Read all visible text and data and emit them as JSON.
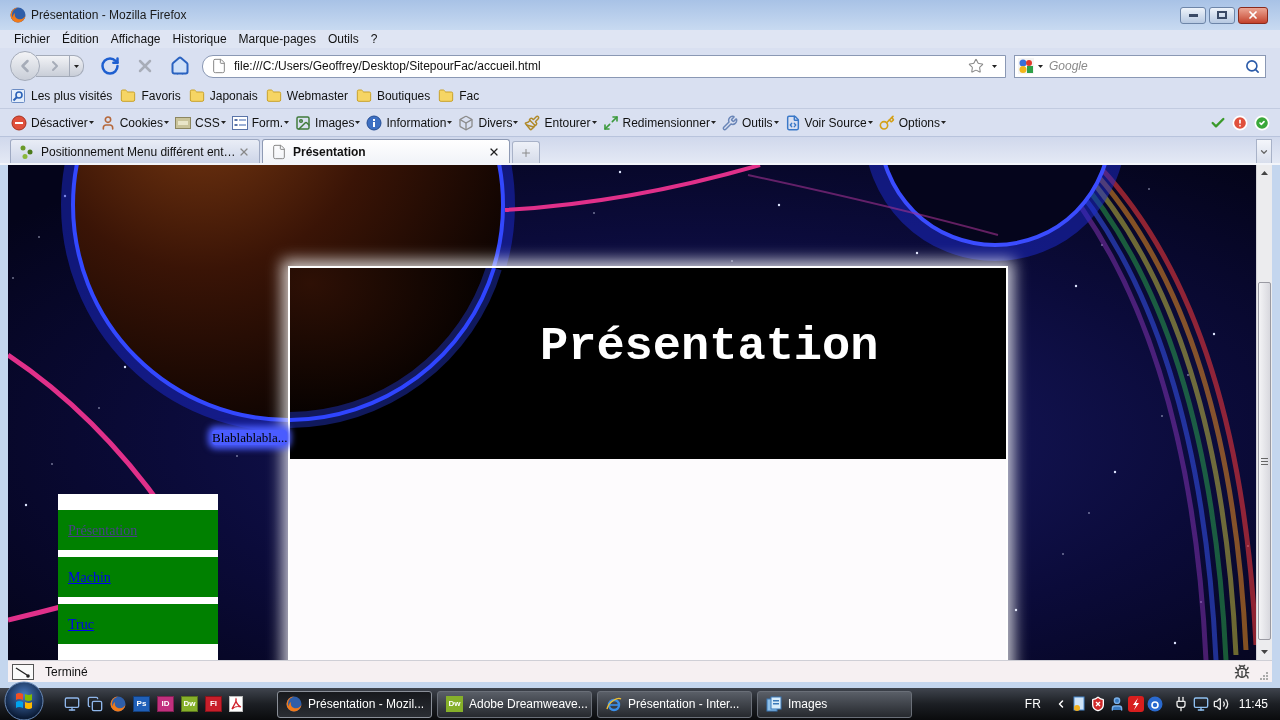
{
  "window": {
    "title": "Présentation - Mozilla Firefox"
  },
  "menu_bar": [
    "Fichier",
    "Édition",
    "Affichage",
    "Historique",
    "Marque-pages",
    "Outils",
    "?"
  ],
  "navigation": {
    "back": {
      "disabled": true
    },
    "forward": {
      "disabled": true
    },
    "stop": {
      "disabled": true
    },
    "url": "file:///C:/Users/Geoffrey/Desktop/SitepourFac/accueil.html",
    "search": {
      "placeholder": "Google"
    }
  },
  "bookmarks": [
    {
      "label": "Les plus visités",
      "kind": "smart"
    },
    {
      "label": "Favoris",
      "kind": "folder"
    },
    {
      "label": "Japonais",
      "kind": "folder"
    },
    {
      "label": "Webmaster",
      "kind": "folder"
    },
    {
      "label": "Boutiques",
      "kind": "folder"
    },
    {
      "label": "Fac",
      "kind": "folder"
    }
  ],
  "developer_toolbar": [
    {
      "label": "Désactiver",
      "kind": "disable"
    },
    {
      "label": "Cookies",
      "kind": "cookies"
    },
    {
      "label": "CSS",
      "kind": "css"
    },
    {
      "label": "Form.",
      "kind": "form"
    },
    {
      "label": "Images",
      "kind": "images"
    },
    {
      "label": "Information",
      "kind": "information"
    },
    {
      "label": "Divers",
      "kind": "misc"
    },
    {
      "label": "Entourer",
      "kind": "outline"
    },
    {
      "label": "Redimensionner",
      "kind": "resize"
    },
    {
      "label": "Outils",
      "kind": "tools"
    },
    {
      "label": "Voir Source",
      "kind": "source"
    },
    {
      "label": "Options",
      "kind": "options"
    }
  ],
  "tabs": [
    {
      "label": "Positionnement Menu différent ent…",
      "selected": false,
      "kind": "site"
    },
    {
      "label": "Présentation",
      "selected": true,
      "kind": "blank"
    }
  ],
  "page": {
    "heading": "Présentation",
    "text": "Blablablabla...",
    "menu": [
      {
        "label": "Présentation",
        "visited": true
      },
      {
        "label": "Machin",
        "visited": false
      },
      {
        "label": "Truc",
        "visited": false
      }
    ]
  },
  "status_bar": {
    "text": "Terminé"
  },
  "taskbar": {
    "quick_launch": [
      {
        "kind": "desktop"
      },
      {
        "kind": "switch"
      },
      {
        "kind": "firefox"
      },
      {
        "kind": "tile",
        "label": "Ps",
        "color": "#1f5fb8"
      },
      {
        "kind": "tile",
        "label": "ID",
        "color": "#c2307e"
      },
      {
        "kind": "tile",
        "label": "Dw",
        "color": "#86b02a"
      },
      {
        "kind": "tile",
        "label": "Fl",
        "color": "#c81e2a"
      },
      {
        "kind": "pdf"
      }
    ],
    "tasks": [
      {
        "label": "Présentation - Mozil...",
        "selected": true,
        "kind": "firefox"
      },
      {
        "label": "Adobe Dreamweave...",
        "selected": false,
        "kind": "tile",
        "icon_label": "Dw",
        "color": "#86b02a"
      },
      {
        "label": "Présentation - Inter...",
        "selected": false,
        "kind": "ie"
      },
      {
        "label": "Images",
        "selected": false,
        "kind": "folder"
      }
    ],
    "language": "FR",
    "clock": "11:45"
  }
}
